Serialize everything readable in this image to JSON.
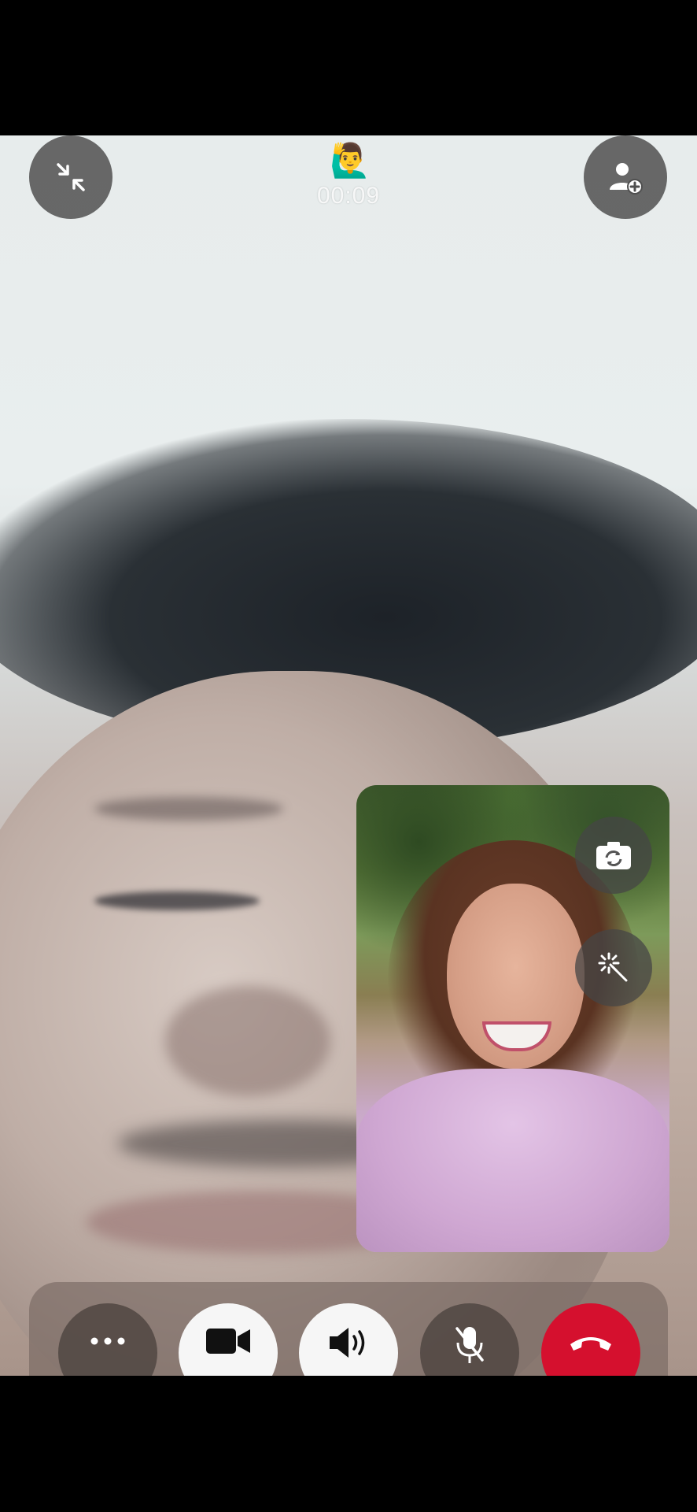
{
  "call": {
    "timer": "00:09",
    "emoji": "🙋‍♂️"
  },
  "top_controls": {
    "minimize_icon": "minimize-arrows-icon",
    "add_person_icon": "add-person-icon"
  },
  "self_view": {
    "flip_icon": "flip-camera-icon",
    "effects_icon": "magic-wand-icon"
  },
  "bottom_controls": [
    {
      "name": "more",
      "icon": "more-dots-icon"
    },
    {
      "name": "video",
      "icon": "video-camera-icon"
    },
    {
      "name": "speaker",
      "icon": "speaker-icon"
    },
    {
      "name": "mute",
      "icon": "mic-off-icon"
    },
    {
      "name": "end-call",
      "icon": "hang-up-icon"
    }
  ],
  "colors": {
    "end_call": "#d5102e",
    "control_bar": "#78625a"
  }
}
